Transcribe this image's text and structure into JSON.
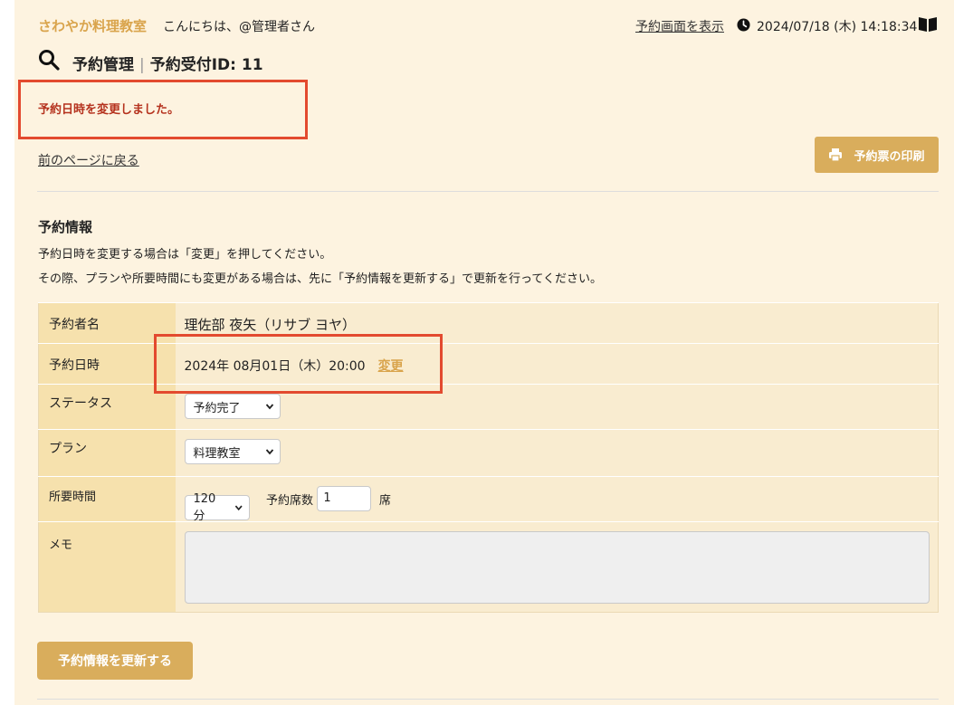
{
  "header": {
    "brand": "さわやか料理教室",
    "greeting": "こんにちは、@管理者さん",
    "view_link": "予約画面を表示",
    "datetime": "2024/07/18 (木) 14:18:34",
    "icons": {
      "clock": "clock-icon",
      "book": "book-icon",
      "search": "search-icon"
    }
  },
  "title": {
    "main": "予約管理",
    "separator": "|",
    "sub": "予約受付ID: 11"
  },
  "flash": "予約日時を変更しました。",
  "back_link": "前のページに戻る",
  "print_button": "予約票の印刷",
  "section": {
    "title": "予約情報",
    "desc1": "予約日時を変更する場合は「変更」を押してください。",
    "desc2": "その際、プランや所要時間にも変更がある場合は、先に「予約情報を更新する」で更新を行ってください。"
  },
  "form": {
    "name_label": "予約者名",
    "name_value": "理佐部 夜矢（リサブ ヨヤ）",
    "datetime_label": "予約日時",
    "datetime_value": "2024年 08月01日（木）20:00",
    "change_link": "変更",
    "status_label": "ステータス",
    "status_value": "予約完了",
    "plan_label": "プラン",
    "plan_value": "料理教室",
    "duration_label": "所要時間",
    "duration_value": "120分",
    "seats_label": "予約席数",
    "seats_value": "1",
    "seats_unit": "席",
    "memo_label": "メモ",
    "memo_value": ""
  },
  "update_button": "予約情報を更新する",
  "colors": {
    "accent": "#d9ad5c",
    "brand": "#d9a44c",
    "flash": "#b5321e",
    "highlight": "#e34a2f"
  }
}
